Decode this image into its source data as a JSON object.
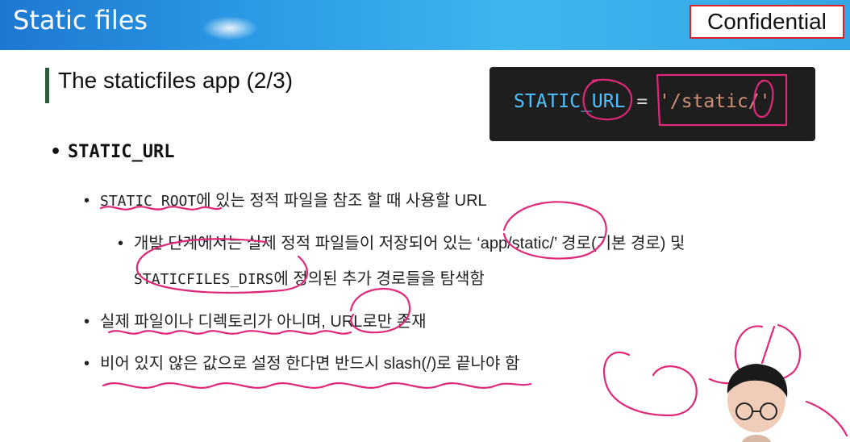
{
  "header": {
    "title": "Static files",
    "badge": "Confidential"
  },
  "subtitle": "The staticfiles app (2/3)",
  "code": {
    "var": "STATIC_URL",
    "op": " = ",
    "str": "'/static/'"
  },
  "bullet_main": "STATIC_URL",
  "bullets": {
    "b1_code": "STATIC_ROOT",
    "b1_text": "에 있는 정적 파일을 참조 할 때 사용할 URL",
    "b2_line1": "개발 단계에서는 실제 정적 파일들이 저장되어 있는 ‘app/static/’ 경로(기본 경로) 및",
    "b2_code": "STATICFILES_DIRS",
    "b2_line2": "에 정의된 추가 경로들을 탐색함",
    "b3": "실제 파일이나 디렉토리가 아니며, URL로만 존재",
    "b4": "비어 있지 않은 값으로 설정 한다면 반드시 slash(/)로 끝나야 함"
  },
  "colors": {
    "header": "#2a9ae6",
    "annotation": "#e0287a",
    "code_bg": "#1e1e1e"
  }
}
